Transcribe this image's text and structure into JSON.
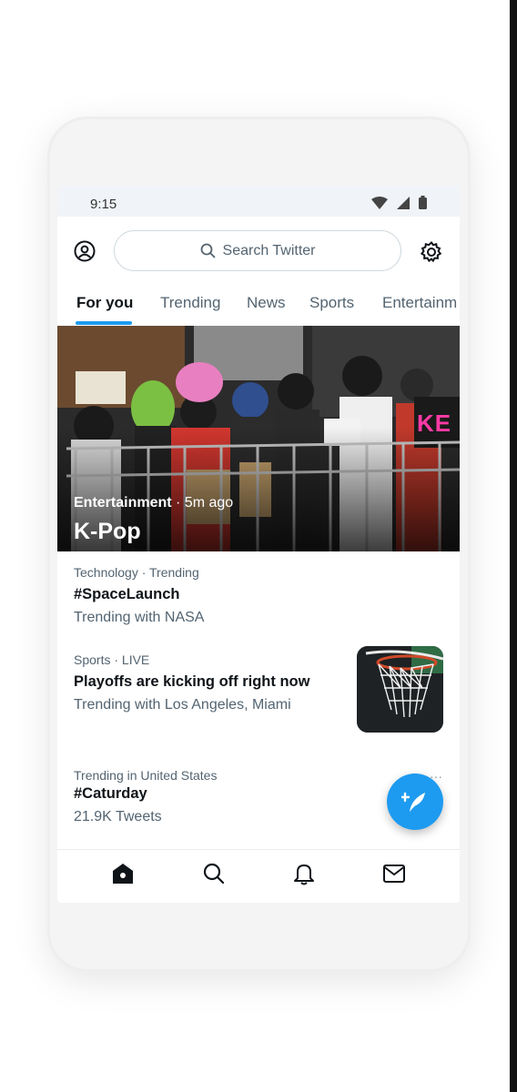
{
  "status_bar": {
    "time": "9:15"
  },
  "search": {
    "placeholder": "Search Twitter"
  },
  "tabs": [
    {
      "label": "For you",
      "active": true
    },
    {
      "label": "Trending",
      "active": false
    },
    {
      "label": "News",
      "active": false
    },
    {
      "label": "Sports",
      "active": false
    },
    {
      "label": "Entertainm",
      "active": false
    }
  ],
  "hero": {
    "category": "Entertainment",
    "time": " · 5m ago",
    "title": "K-Pop",
    "sign_text": "KE"
  },
  "trends": [
    {
      "meta": "Technology · Trending",
      "title": "#SpaceLaunch",
      "sub": "Trending with NASA"
    },
    {
      "meta": "Sports · LIVE",
      "title": "Playoffs are kicking off right now",
      "sub": "Trending with Los Angeles, Miami"
    },
    {
      "meta": "Trending in United States",
      "title": "#Caturday",
      "sub": "21.9K Tweets"
    }
  ],
  "more_glyph": "···",
  "icons": {
    "profile": "profile-icon",
    "search": "search-icon",
    "settings": "gear-icon",
    "compose": "compose-tweet-icon",
    "home": "home-icon",
    "explore": "search-icon",
    "notifications": "bell-icon",
    "messages": "mail-icon"
  },
  "colors": {
    "accent": "#1d9bf0",
    "text": "#0f1419",
    "secondary": "#536471"
  }
}
